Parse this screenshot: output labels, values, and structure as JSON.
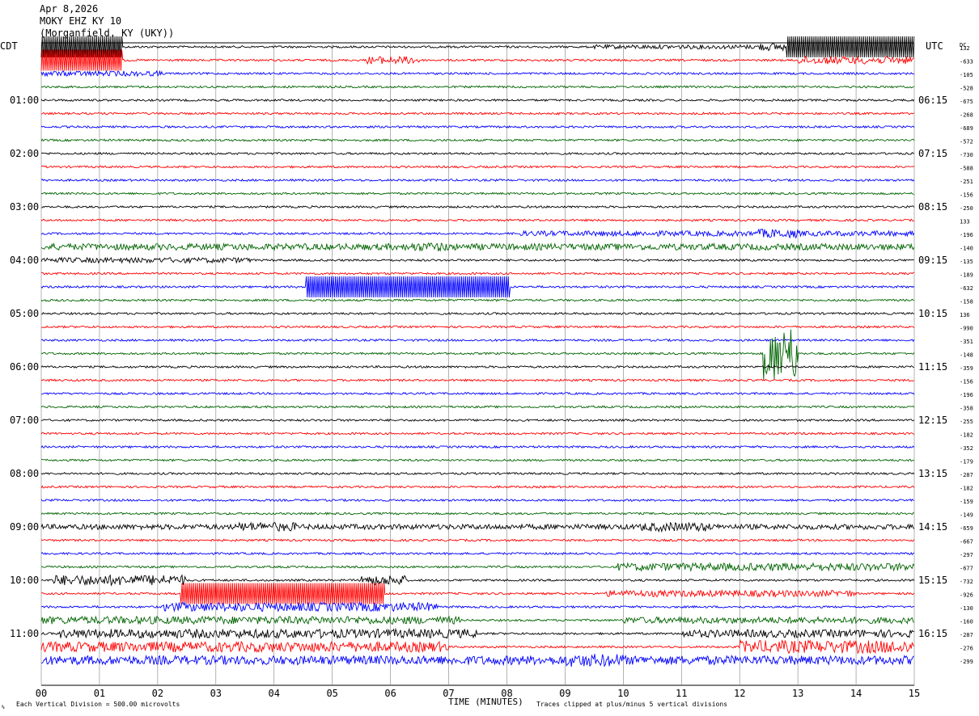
{
  "header": {
    "line1": "Apr 8,2026",
    "line2": "MOKY EHZ KY 10",
    "line3": "(Morganfield, KY (UKY))"
  },
  "left_zone": "CDT",
  "right_zone": "UTC",
  "dc_label": "DC",
  "footer": {
    "division": "Each Vertical Division =  500.00 microvolts",
    "clipping": "Traces clipped at plus/minus 5 vertical divisions",
    "corner_mark": "%"
  },
  "colors": {
    "trace_cycle": [
      "#000000",
      "#ff0000",
      "#0000ff",
      "#006400"
    ],
    "grid": "#808080",
    "frame": "#000000"
  },
  "chart_data": {
    "type": "line",
    "title": "",
    "xlabel": "TIME (MINUTES)",
    "ylabel": "",
    "x_ticks": [
      "00",
      "01",
      "02",
      "03",
      "04",
      "05",
      "06",
      "07",
      "08",
      "09",
      "10",
      "11",
      "12",
      "13",
      "14",
      "15"
    ],
    "xlim": [
      0,
      15
    ],
    "grid": true,
    "left_hour_labels": [
      "01:00",
      "02:00",
      "03:00",
      "04:00",
      "05:00",
      "06:00",
      "07:00",
      "08:00",
      "09:00",
      "10:00",
      "11:00"
    ],
    "right_hour_labels": [
      "06:15",
      "07:15",
      "08:15",
      "09:15",
      "10:15",
      "11:15",
      "12:15",
      "13:15",
      "14:15",
      "15:15",
      "16:15"
    ],
    "dc_offsets": [
      "132",
      "-633",
      "-105",
      "-528",
      "-675",
      "-268",
      "-689",
      "-572",
      "-730",
      "-588",
      "-251",
      "-156",
      "-250",
      "133",
      "-196",
      "-140",
      "-135",
      "-189",
      "-632",
      "-158",
      "136",
      "-990",
      "-351",
      "-148",
      "-359",
      "-156",
      "-196",
      "-358",
      "-255",
      "-182",
      "-352",
      "-179",
      "-287",
      "-182",
      "-159",
      "-149",
      "-659",
      "-667",
      "-297",
      "-677",
      "-732",
      "-926",
      "-130",
      "-160",
      "-287",
      "-276",
      "-299"
    ],
    "events": [
      {
        "row": 0,
        "start": 0.0,
        "end": 1.4,
        "amp": 5,
        "kind": "clip"
      },
      {
        "row": 0,
        "start": 9.5,
        "end": 12.3,
        "amp": 1.6,
        "kind": "noise"
      },
      {
        "row": 0,
        "start": 12.3,
        "end": 12.8,
        "amp": 3,
        "kind": "noise"
      },
      {
        "row": 0,
        "start": 12.8,
        "end": 15,
        "amp": 5,
        "kind": "clip"
      },
      {
        "row": 1,
        "start": 0.0,
        "end": 1.4,
        "amp": 5,
        "kind": "clip"
      },
      {
        "row": 1,
        "start": 5.6,
        "end": 6.5,
        "amp": 3,
        "kind": "noise"
      },
      {
        "row": 1,
        "start": 13.0,
        "end": 15,
        "amp": 3,
        "kind": "noise"
      },
      {
        "row": 2,
        "start": 0.0,
        "end": 2.1,
        "amp": 2,
        "kind": "noise"
      },
      {
        "row": 14,
        "start": 8.2,
        "end": 15,
        "amp": 2,
        "kind": "noise"
      },
      {
        "row": 14,
        "start": 12.3,
        "end": 13.0,
        "amp": 3.5,
        "kind": "noise"
      },
      {
        "row": 15,
        "start": 0.0,
        "end": 15,
        "amp": 2.5,
        "kind": "noise"
      },
      {
        "row": 15,
        "start": 6.3,
        "end": 7.0,
        "amp": 3.5,
        "kind": "noise"
      },
      {
        "row": 16,
        "start": 0.0,
        "end": 3.6,
        "amp": 2,
        "kind": "noise"
      },
      {
        "row": 18,
        "start": 4.55,
        "end": 8.05,
        "amp": 5,
        "kind": "clip"
      },
      {
        "row": 23,
        "start": 12.4,
        "end": 13.0,
        "amp": 8,
        "kind": "spike"
      },
      {
        "row": 36,
        "start": 0.0,
        "end": 15,
        "amp": 2,
        "kind": "noise"
      },
      {
        "row": 36,
        "start": 3.4,
        "end": 4.4,
        "amp": 3.5,
        "kind": "noise"
      },
      {
        "row": 36,
        "start": 10.3,
        "end": 11.5,
        "amp": 3.5,
        "kind": "noise"
      },
      {
        "row": 39,
        "start": 9.9,
        "end": 15,
        "amp": 3,
        "kind": "noise"
      },
      {
        "row": 40,
        "start": 0.2,
        "end": 2.5,
        "amp": 4,
        "kind": "noise"
      },
      {
        "row": 40,
        "start": 5.5,
        "end": 6.3,
        "amp": 4,
        "kind": "noise"
      },
      {
        "row": 41,
        "start": 2.4,
        "end": 5.9,
        "amp": 5,
        "kind": "clip"
      },
      {
        "row": 41,
        "start": 9.7,
        "end": 14.0,
        "amp": 2.5,
        "kind": "noise"
      },
      {
        "row": 42,
        "start": 2.1,
        "end": 6.8,
        "amp": 3.5,
        "kind": "noise"
      },
      {
        "row": 43,
        "start": 0.0,
        "end": 7.2,
        "amp": 3,
        "kind": "noise"
      },
      {
        "row": 43,
        "start": 10.0,
        "end": 15,
        "amp": 2.5,
        "kind": "noise"
      },
      {
        "row": 44,
        "start": 0.3,
        "end": 7.5,
        "amp": 3.5,
        "kind": "noise"
      },
      {
        "row": 44,
        "start": 11.0,
        "end": 15,
        "amp": 3,
        "kind": "noise"
      },
      {
        "row": 45,
        "start": 0.0,
        "end": 7.0,
        "amp": 4,
        "kind": "noise"
      },
      {
        "row": 45,
        "start": 12.0,
        "end": 15,
        "amp": 5,
        "kind": "noise"
      },
      {
        "row": 46,
        "start": 0.0,
        "end": 15,
        "amp": 3.5,
        "kind": "noise"
      },
      {
        "row": 46,
        "start": 9.0,
        "end": 10.0,
        "amp": 5,
        "kind": "noise"
      }
    ]
  }
}
